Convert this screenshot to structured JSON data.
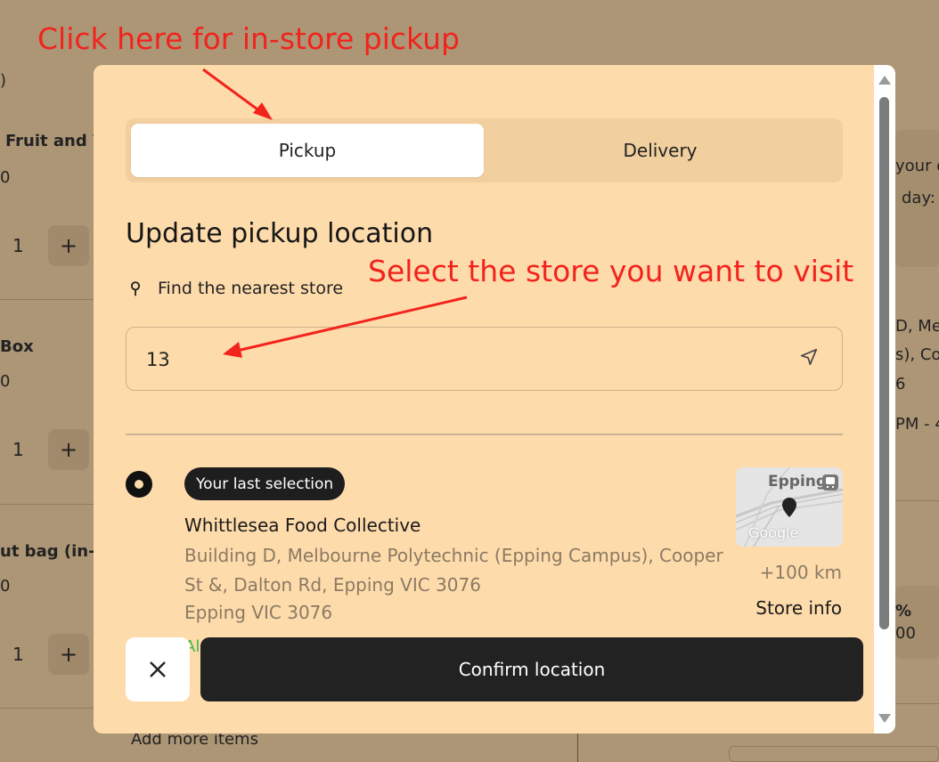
{
  "background": {
    "snippets": [
      {
        "text": ")"
      },
      {
        "text": "Fruit and V"
      },
      {
        "text": "0"
      },
      {
        "text": "Box"
      },
      {
        "text": "0"
      },
      {
        "text": "ut bag (in-s"
      },
      {
        "text": "0"
      },
      {
        "text": "your o"
      },
      {
        "text": "day:"
      },
      {
        "text": "D, Me"
      },
      {
        "text": "s), Coo"
      },
      {
        "text": "6"
      },
      {
        "text": "PM - 4"
      },
      {
        "text": "%"
      },
      {
        "text": "00"
      }
    ],
    "quantities": [
      "1",
      "1",
      "1"
    ],
    "plus_label": "+",
    "add_more": "Add more items"
  },
  "annotations": {
    "pickup_hint": "Click here for in-store pickup",
    "store_hint": "Select the store you want to visit",
    "color": "#f2231c"
  },
  "modal": {
    "tabs": [
      {
        "label": "Pickup",
        "active": true
      },
      {
        "label": "Delivery",
        "active": false
      }
    ],
    "heading": "Update pickup location",
    "find_nearest": "Find the nearest store",
    "search": {
      "value": "13",
      "placeholder": ""
    },
    "store": {
      "badge": "Your last selection",
      "name": "Whittlesea Food Collective",
      "address": "Building D, Melbourne Polytechnic (Epping Campus), Cooper St &, Dalton Rd, Epping VIC 3076",
      "suburb": "Epping VIC 3076",
      "status": "Al",
      "map_label": "Epping",
      "map_brand": "Google",
      "distance": "+100 km",
      "info_link": "Store info",
      "selected": true
    },
    "close_label": "×",
    "confirm_label": "Confirm location"
  },
  "icons": {
    "pin": "map-pin-icon",
    "navigate": "navigation-arrow-icon",
    "close": "close-icon",
    "transit": "train-icon"
  },
  "colors": {
    "modal_bg": "#fedbab",
    "toggle_bg": "#f1cf9e",
    "confirm_bg": "#222222",
    "status_green": "#3db84a",
    "address_grey": "#8b7a63"
  }
}
